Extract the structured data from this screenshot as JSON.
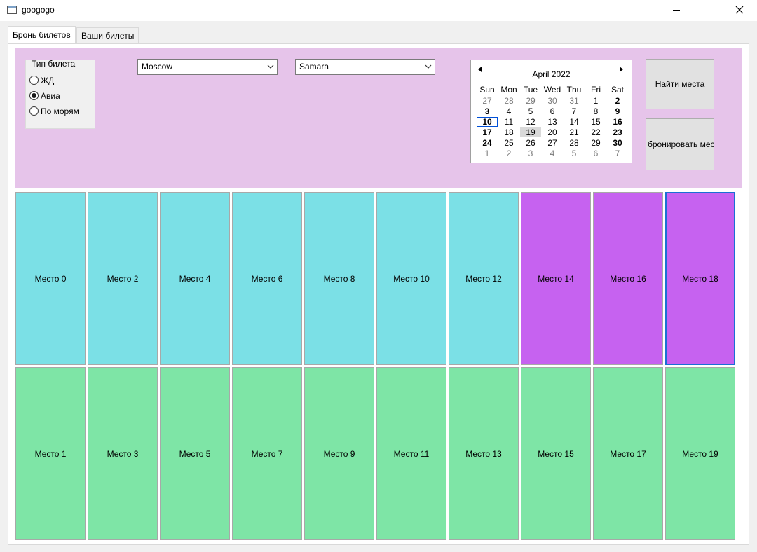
{
  "window": {
    "title": "googogo",
    "icon": "window-app-icon"
  },
  "titlebar_buttons": {
    "minimize_icon": "minimize-icon",
    "maximize_icon": "maximize-icon",
    "close_icon": "close-icon"
  },
  "tabs": [
    {
      "label": "Бронь билетов",
      "selected": true
    },
    {
      "label": "Ваши билеты",
      "selected": false
    }
  ],
  "ticket_type": {
    "title": "Тип билета",
    "options": [
      {
        "label": "ЖД",
        "checked": false
      },
      {
        "label": "Авиа",
        "checked": true
      },
      {
        "label": "По морям",
        "checked": false
      }
    ]
  },
  "route": {
    "from": "Moscow",
    "to": "Samara"
  },
  "calendar": {
    "month_label": "April 2022",
    "weekdays": [
      "Sun",
      "Mon",
      "Tue",
      "Wed",
      "Thu",
      "Fri",
      "Sat"
    ],
    "weeks": [
      [
        "27",
        "28",
        "29",
        "30",
        "31",
        "1",
        "2"
      ],
      [
        "3",
        "4",
        "5",
        "6",
        "7",
        "8",
        "9"
      ],
      [
        "10",
        "11",
        "12",
        "13",
        "14",
        "15",
        "16"
      ],
      [
        "17",
        "18",
        "19",
        "20",
        "21",
        "22",
        "23"
      ],
      [
        "24",
        "25",
        "26",
        "27",
        "28",
        "29",
        "30"
      ],
      [
        "1",
        "2",
        "3",
        "4",
        "5",
        "6",
        "7"
      ]
    ],
    "today": "10",
    "selected": "19",
    "bold_days": [
      "2",
      "3",
      "9",
      "10",
      "16",
      "17",
      "23",
      "24",
      "30"
    ]
  },
  "actions": {
    "find_label": "Найти места",
    "book_label": "бронировать мес"
  },
  "seat_colors": {
    "free": "#7be0e6",
    "taken": "#c662f0",
    "other": "#7ee5a6",
    "panel": "#e6c4ea",
    "focus": "#1a6fd4"
  },
  "seats_top": [
    {
      "label": "Место 0",
      "state": "free"
    },
    {
      "label": "Место 2",
      "state": "free"
    },
    {
      "label": "Место 4",
      "state": "free"
    },
    {
      "label": "Место 6",
      "state": "free"
    },
    {
      "label": "Место 8",
      "state": "free"
    },
    {
      "label": "Место 10",
      "state": "free"
    },
    {
      "label": "Место 12",
      "state": "free"
    },
    {
      "label": "Место 14",
      "state": "taken"
    },
    {
      "label": "Место 16",
      "state": "taken"
    },
    {
      "label": "Место 18",
      "state": "taken",
      "focused": true
    }
  ],
  "seats_bottom": [
    {
      "label": "Место 1",
      "state": "other"
    },
    {
      "label": "Место 3",
      "state": "other"
    },
    {
      "label": "Место 5",
      "state": "other"
    },
    {
      "label": "Место 7",
      "state": "other"
    },
    {
      "label": "Место 9",
      "state": "other"
    },
    {
      "label": "Место 11",
      "state": "other"
    },
    {
      "label": "Место 13",
      "state": "other"
    },
    {
      "label": "Место 15",
      "state": "other"
    },
    {
      "label": "Место 17",
      "state": "other"
    },
    {
      "label": "Место 19",
      "state": "other"
    }
  ]
}
